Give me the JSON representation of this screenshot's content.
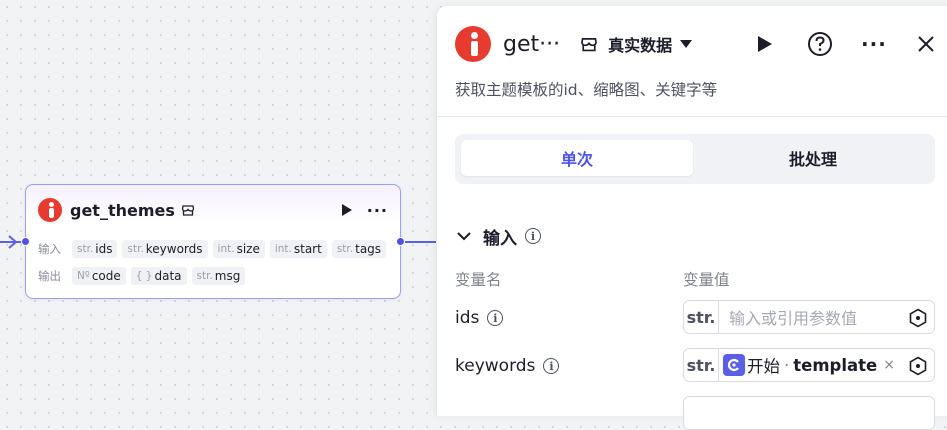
{
  "node": {
    "title": "get_themes",
    "input_label": "输入",
    "output_label": "输出",
    "inputs": [
      {
        "type": "str.",
        "name": "ids"
      },
      {
        "type": "str.",
        "name": "keywords"
      },
      {
        "type": "int.",
        "name": "size"
      },
      {
        "type": "int.",
        "name": "start"
      },
      {
        "type": "str.",
        "name": "tags"
      }
    ],
    "outputs": [
      {
        "type": "Nº",
        "name": "code"
      },
      {
        "type": "{ }",
        "name": "data"
      },
      {
        "type": "str.",
        "name": "msg"
      }
    ],
    "more_label": "···"
  },
  "panel": {
    "title": "get···",
    "data_mode": "真实数据",
    "more_label": "···",
    "description": "获取主题模板的id、缩略图、关键字等",
    "tabs": [
      "单次",
      "批处理"
    ],
    "active_tab": "单次",
    "input_section": "输入",
    "col_name": "变量名",
    "col_value": "变量值",
    "params": [
      {
        "name": "ids",
        "type": "str.",
        "placeholder": "输入或引用参数值"
      },
      {
        "name": "keywords",
        "type": "str.",
        "ref_source": "开始",
        "ref_sep": "·",
        "ref_var": "template",
        "remove": "×"
      }
    ]
  },
  "colors": {
    "accent": "#4d53e8",
    "brand": "#e63b2e",
    "edge": "#5b5fe6"
  }
}
